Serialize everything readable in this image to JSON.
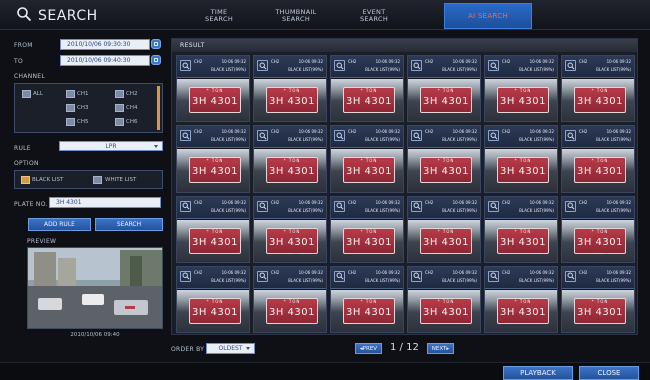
{
  "header": {
    "title": "SEARCH",
    "tabs": [
      "TIME\nSEARCH",
      "THUMBNAIL\nSEARCH",
      "EVENT\nSEARCH",
      "AI SEARCH"
    ]
  },
  "filters": {
    "from_label": "FROM",
    "from_value": "2010/10/06 09:30:30",
    "to_label": "TO",
    "to_value": "2010/10/06 09:40:30",
    "channel_label": "CHANNEL",
    "channels": [
      "ALL",
      "CH1",
      "CH2",
      "CH3",
      "CH4",
      "CH5",
      "CH6"
    ],
    "rule_label": "RULE",
    "rule_value": "LPR",
    "option_label": "OPTION",
    "options": [
      "BLACK LIST",
      "WHITE LIST"
    ],
    "plate_label": "PLATE NO.",
    "plate_value": "3H 4301",
    "add_rule": "ADD RULE",
    "search": "SEARCH",
    "preview_label": "PREVIEW",
    "preview_timestamp": "2010/10/06 09:40"
  },
  "result": {
    "header": "RESULT",
    "card": {
      "channel": "CH2",
      "datetime": "10-06 09:32",
      "tag": "BLACK LIST(99%)",
      "plate_top": "* TON",
      "plate_number": "3H 4301"
    }
  },
  "bottom": {
    "order_label": "ORDER BY",
    "order_value": "OLDEST",
    "prev": "◂PREV",
    "page": "1 / 12",
    "next": "NEXT▸"
  },
  "footer": {
    "playback": "PLAYBACK",
    "close": "CLOSE"
  }
}
